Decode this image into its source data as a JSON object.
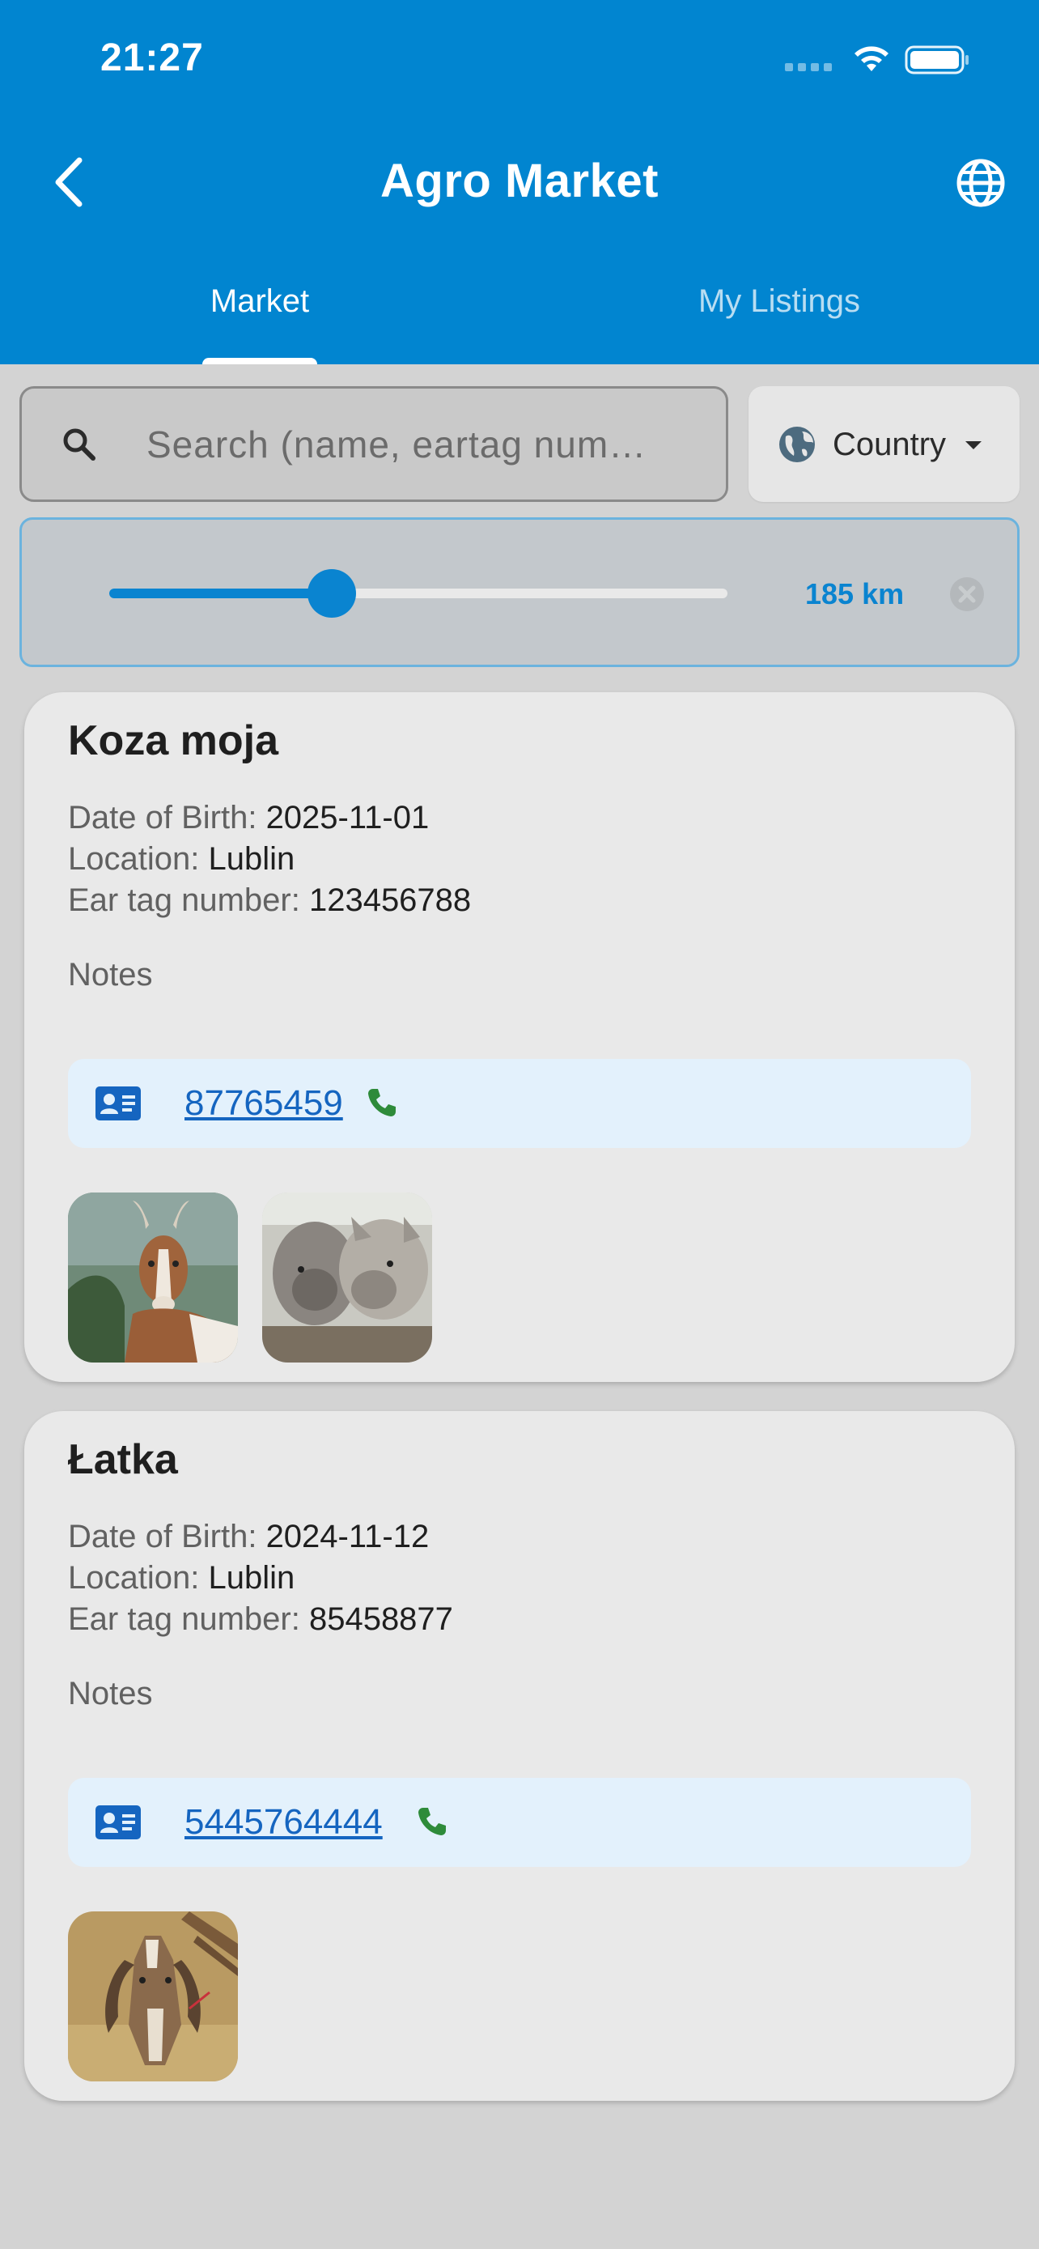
{
  "status_bar": {
    "time": "21:27"
  },
  "header": {
    "title": "Agro Market",
    "back_icon": "chevron-left-icon",
    "language_icon": "globe-icon",
    "tabs": [
      {
        "label": "Market",
        "active": true
      },
      {
        "label": "My Listings",
        "active": false
      }
    ],
    "color": "#0185d0"
  },
  "search": {
    "placeholder": "Search (name, eartag num…",
    "value": "",
    "country_label": "Country"
  },
  "distance_filter": {
    "value_label": "185 km",
    "slider_fraction": 0.36,
    "accent": "#0a84d0"
  },
  "listings": [
    {
      "name": "Koza moja",
      "dob_label": "Date of Birth:",
      "dob": "2025-11-01",
      "location_label": "Location:",
      "location": "Lublin",
      "eartag_label": "Ear tag number:",
      "eartag": "123456788",
      "notes_label": "Notes",
      "phone": "87765459",
      "photos": [
        "goat-photo",
        "goats-photo"
      ]
    },
    {
      "name": "Łatka",
      "dob_label": "Date of Birth:",
      "dob": "2024-11-12",
      "location_label": "Location:",
      "location": "Lublin",
      "eartag_label": "Ear tag number:",
      "eartag": "85458877",
      "notes_label": "Notes",
      "phone": "5445764444",
      "photos": [
        "goat-photo"
      ]
    }
  ]
}
